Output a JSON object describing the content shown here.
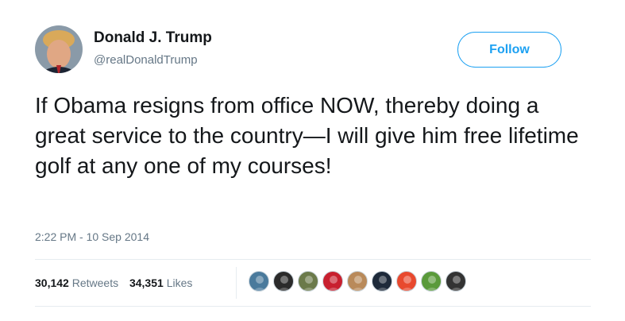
{
  "tweet": {
    "display_name": "Donald J. Trump",
    "handle": "@realDonaldTrump",
    "follow_label": "Follow",
    "text": "If Obama resigns from office NOW, thereby doing a great service to the country—I will give him free lifetime golf at any one of my courses!",
    "timestamp": "2:22 PM - 10 Sep 2014"
  },
  "stats": {
    "retweets_count": "30,142",
    "retweets_label": "Retweets",
    "likes_count": "34,351",
    "likes_label": "Likes"
  },
  "likers": [
    {
      "color": "#4a7a9c"
    },
    {
      "color": "#2b2b2b"
    },
    {
      "color": "#6b7a4a"
    },
    {
      "color": "#c8202f"
    },
    {
      "color": "#b98a5a"
    },
    {
      "color": "#1e2a3a"
    },
    {
      "color": "#e8492e"
    },
    {
      "color": "#5a9a3a"
    },
    {
      "color": "#333333"
    }
  ],
  "colors": {
    "accent": "#1da1f2",
    "text": "#14171a",
    "secondary_text": "#657786",
    "divider": "#e6ecf0"
  }
}
